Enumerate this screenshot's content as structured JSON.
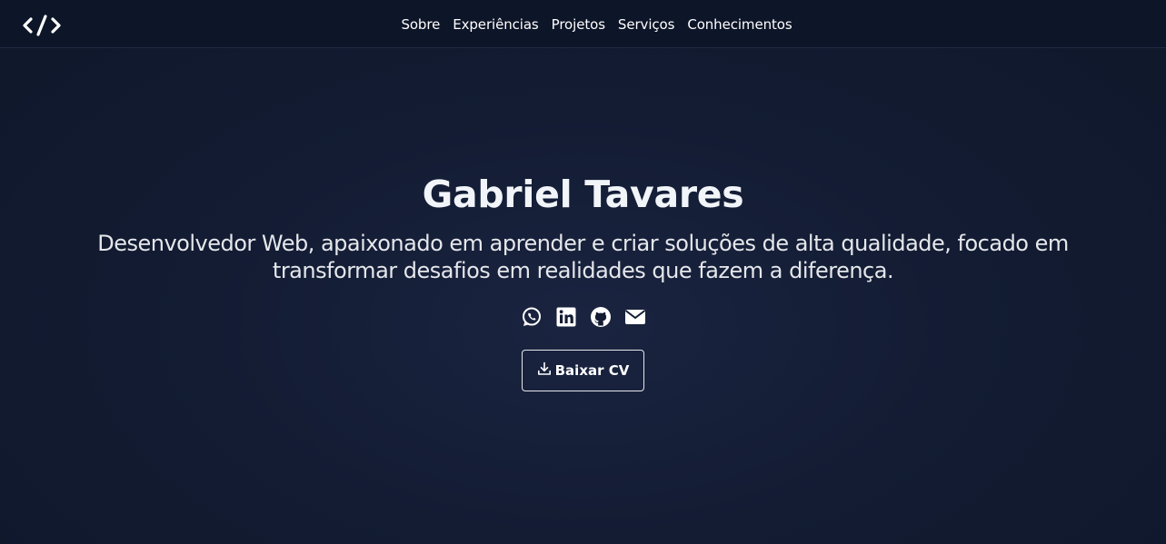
{
  "navbar": {
    "logo_icon": "code-brackets-icon",
    "links": [
      {
        "label": "Sobre"
      },
      {
        "label": "Experiências"
      },
      {
        "label": "Projetos"
      },
      {
        "label": "Serviços"
      },
      {
        "label": "Conhecimentos"
      }
    ]
  },
  "hero": {
    "name": "Gabriel Tavares",
    "tagline": "Desenvolvedor Web, apaixonado em aprender e criar soluções de alta qualidade, focado em transformar desafios em realidades que fazem a diferença.",
    "social_icons": [
      "whatsapp-icon",
      "linkedin-icon",
      "github-icon",
      "envelope-icon"
    ],
    "cv_button": {
      "label": "Baixar CV",
      "icon": "download-icon"
    }
  },
  "colors": {
    "background": "#0f172a",
    "navbar": "#0d1528",
    "text": "#f1f5f9",
    "button_border": "#e5e7eb"
  }
}
